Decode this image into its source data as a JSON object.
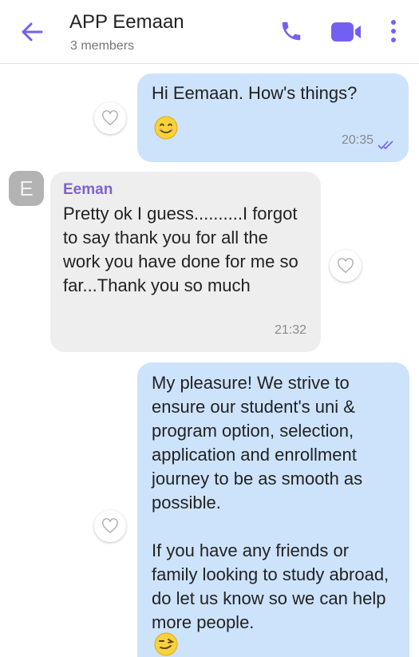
{
  "header": {
    "title": "APP Eemaan",
    "subtitle": "3 members",
    "icons": {
      "back": "back-arrow-icon",
      "call": "phone-icon",
      "video": "video-camera-icon",
      "more": "more-vertical-icon"
    },
    "accent": "#7360f2"
  },
  "messages": [
    {
      "direction": "outgoing",
      "text": "Hi Eemaan. How's things?",
      "emoji": "smiling-face-emoji",
      "time": "20:35",
      "status": "read-ticks-icon"
    },
    {
      "direction": "incoming",
      "avatar_letter": "E",
      "sender": "Eeman",
      "text": "Pretty ok I guess..........I forgot to say thank you for all the work you have done for me so far...Thank you so much",
      "time": "21:32"
    },
    {
      "direction": "outgoing",
      "paragraph1": "My pleasure! We strive to ensure our student's uni & program option, selection, application and enrollment journey to be as smooth as possible.",
      "paragraph2": "If you have any friends or family looking to study abroad, do let us know so we can help more people.",
      "emoji": "winking-face-emoji"
    }
  ],
  "colors": {
    "outgoing_bubble": "#cde3fb",
    "incoming_bubble": "#eeeeee",
    "sender_name": "#7b63d0"
  }
}
